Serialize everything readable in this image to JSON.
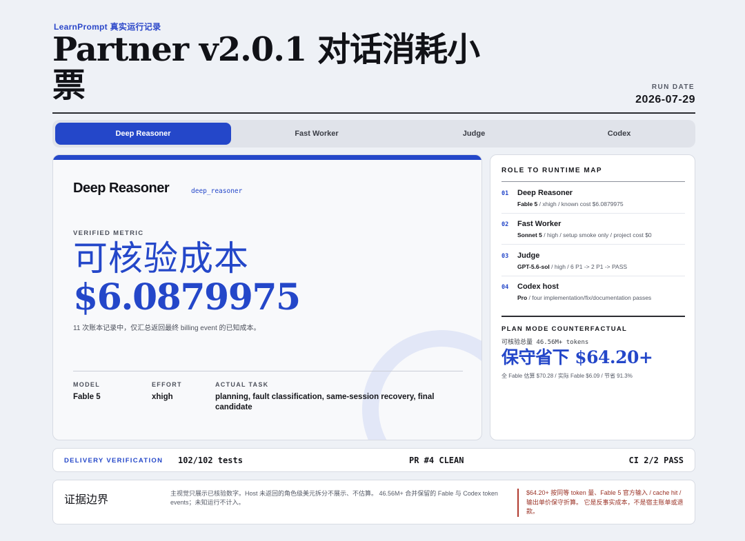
{
  "header": {
    "eyebrow": "LearnPrompt 真实运行记录",
    "title": "Partner v2.0.1 对话消耗小票",
    "run_date_label": "RUN DATE",
    "run_date": "2026-07-29"
  },
  "tabs": [
    {
      "label": "Deep Reasoner",
      "active": true
    },
    {
      "label": "Fast Worker",
      "active": false
    },
    {
      "label": "Judge",
      "active": false
    },
    {
      "label": "Codex",
      "active": false
    }
  ],
  "main": {
    "title": "Deep Reasoner",
    "key": "deep_reasoner",
    "metric_label": "VERIFIED METRIC",
    "metric_title": "可核验成本",
    "metric_value": "$6.0879975",
    "metric_note": "11 次账本记录中，仅汇总返回最终 billing event 的已知成本。",
    "model_label": "MODEL",
    "model": "Fable 5",
    "effort_label": "EFFORT",
    "effort": "xhigh",
    "task_label": "ACTUAL TASK",
    "task": "planning, fault classification, same-session recovery, final candidate"
  },
  "side": {
    "heading": "ROLE TO RUNTIME MAP",
    "roles": [
      {
        "num": "01",
        "name": "Deep Reasoner",
        "model": "Fable 5",
        "detail": " / xhigh / known cost $6.0879975"
      },
      {
        "num": "02",
        "name": "Fast Worker",
        "model": "Sonnet 5",
        "detail": " / high / setup smoke only / project cost $0"
      },
      {
        "num": "03",
        "name": "Judge",
        "model": "GPT-5.6-sol",
        "detail": " / high / 6 P1 -> 2 P1 -> PASS"
      },
      {
        "num": "04",
        "name": "Codex host",
        "model": "Pro",
        "detail": " / four implementation/fix/documentation passes"
      }
    ],
    "plan_head": "PLAN MODE COUNTERFACTUAL",
    "plan_sub": "可核验总量 46.56M+ tokens",
    "plan_big": "保守省下 $64.20+",
    "plan_note": "全 Fable 估算 $70.28 / 实际 Fable $6.09 / 节省 91.3%"
  },
  "delivery": {
    "label": "DELIVERY VERIFICATION",
    "tests": "102/102 tests",
    "pr": "PR #4 CLEAN",
    "ci": "CI 2/2 PASS"
  },
  "evidence": {
    "title": "证据边界",
    "text": "主视觉只展示已核验数字。Host 未返回的角色级美元拆分不展示、不估算。 46.56M+ 合并保留的 Fable 与 Codex token events；未知运行不计入。",
    "warning": "$64.20+ 按同等 token 量、Fable 5 官方输入 / cache hit / 输出单价保守折算。 它是反事实成本，不是宿主账单或退款。"
  },
  "colors": {
    "accent": "#2447c9",
    "warning": "#9a3226",
    "background": "#eef1f6"
  }
}
